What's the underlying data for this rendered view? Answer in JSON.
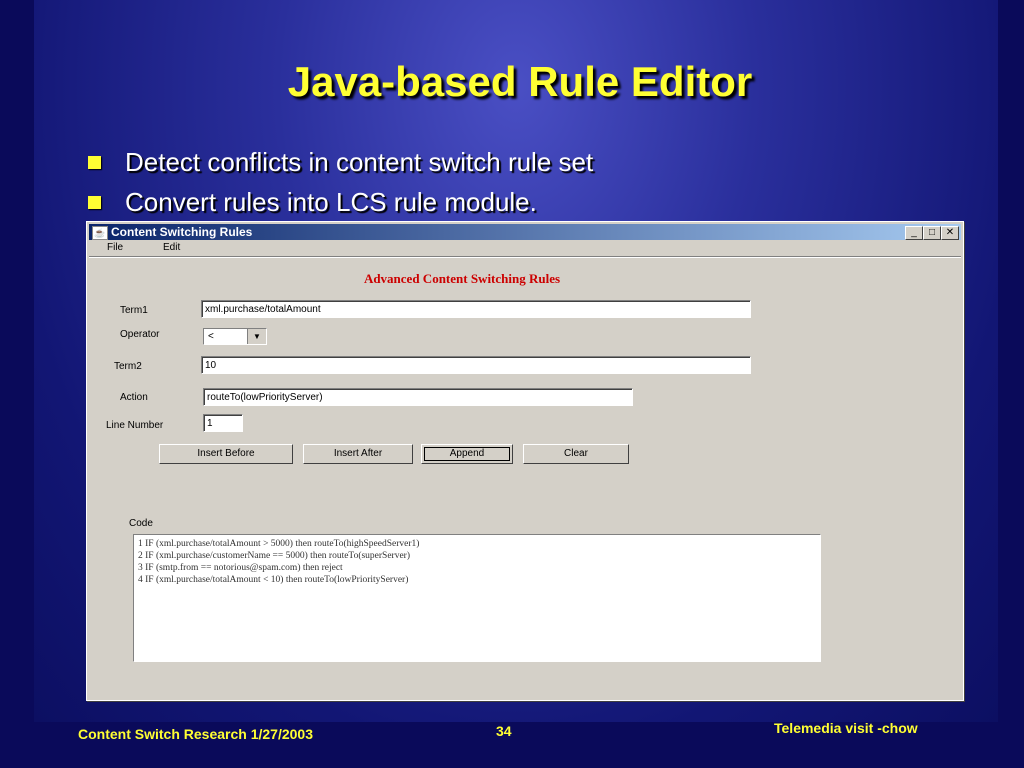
{
  "slide": {
    "title": "Java-based Rule Editor",
    "bullets": [
      "Detect conflicts in content switch rule set",
      "Convert rules into LCS rule module."
    ]
  },
  "window": {
    "title": "Content Switching Rules",
    "controls": {
      "minimize": "_",
      "maximize": "□",
      "close": "✕"
    },
    "menu": [
      "File",
      "Edit"
    ],
    "heading": "Advanced Content Switching Rules",
    "term1": {
      "label": "Term1",
      "value": "xml.purchase/totalAmount"
    },
    "operator": {
      "label": "Operator",
      "value": "<"
    },
    "term2": {
      "label": "Term2",
      "value": "10"
    },
    "action": {
      "label": "Action",
      "value": "routeTo(lowPriorityServer)"
    },
    "line_number": {
      "label": "Line Number",
      "value": "1"
    },
    "buttons": {
      "insert_before": "Insert Before",
      "insert_after": "Insert After",
      "append": "Append",
      "clear": "Clear"
    },
    "code": {
      "label": "Code",
      "lines": [
        "1 IF (xml.purchase/totalAmount > 5000) then routeTo(highSpeedServer1)",
        "2 IF (xml.purchase/customerName == 5000) then routeTo(superServer)",
        "3 IF (smtp.from == notorious@spam.com) then reject",
        "4 IF (xml.purchase/totalAmount < 10) then routeTo(lowPriorityServer)"
      ]
    }
  },
  "footer": {
    "left": "Content Switch Research 1/27/2003",
    "page": "34",
    "right": "Telemedia visit -chow"
  },
  "colors": {
    "title": "#ffff33",
    "accent": "#0a246a",
    "heading": "#cc0000"
  }
}
